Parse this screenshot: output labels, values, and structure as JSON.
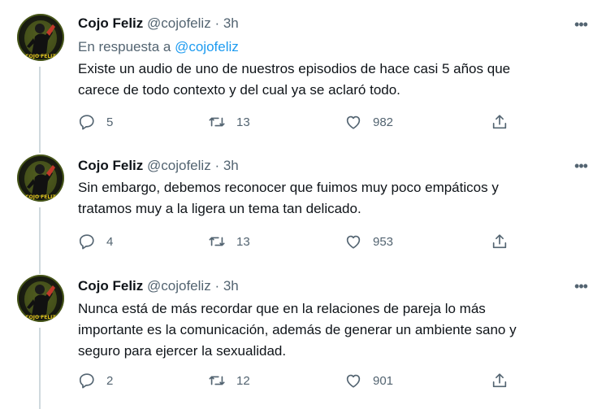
{
  "tweets": [
    {
      "name": "Cojo Feliz",
      "handle": "@cojofeliz",
      "separator": "·",
      "time": "3h",
      "reply_prefix": "En respuesta a",
      "reply_mention": "@cojofeliz",
      "text_lines": [
        "Existe un audio de uno de nuestros episodios de hace casi 5 años que",
        "carece de todo contexto y del cual ya se aclaró todo."
      ],
      "replies": "5",
      "retweets": "13",
      "likes": "982"
    },
    {
      "name": "Cojo Feliz",
      "handle": "@cojofeliz",
      "separator": "·",
      "time": "3h",
      "text_lines": [
        "Sin embargo, debemos reconocer que fuimos muy poco empáticos y",
        "tratamos muy a la ligera un tema tan delicado."
      ],
      "replies": "4",
      "retweets": "13",
      "likes": "953"
    },
    {
      "name": "Cojo Feliz",
      "handle": "@cojofeliz",
      "separator": "·",
      "time": "3h",
      "text_lines": [
        "Nunca está de más recordar que en la relaciones de pareja lo más",
        "importante es la comunicación, además de  generar un ambiente sano y",
        "seguro para ejercer la sexualidad."
      ],
      "replies": "2",
      "retweets": "12",
      "likes": "901"
    }
  ],
  "more_glyph": "•••",
  "avatar_text": "COJO FELIZ",
  "colors": {
    "text": "#0f1419",
    "secondary": "#536471",
    "link": "#1d9bf0",
    "thread_line": "#cfd9de"
  },
  "icons": [
    "reply-icon",
    "retweet-icon",
    "like-icon",
    "share-icon",
    "more-icon"
  ]
}
